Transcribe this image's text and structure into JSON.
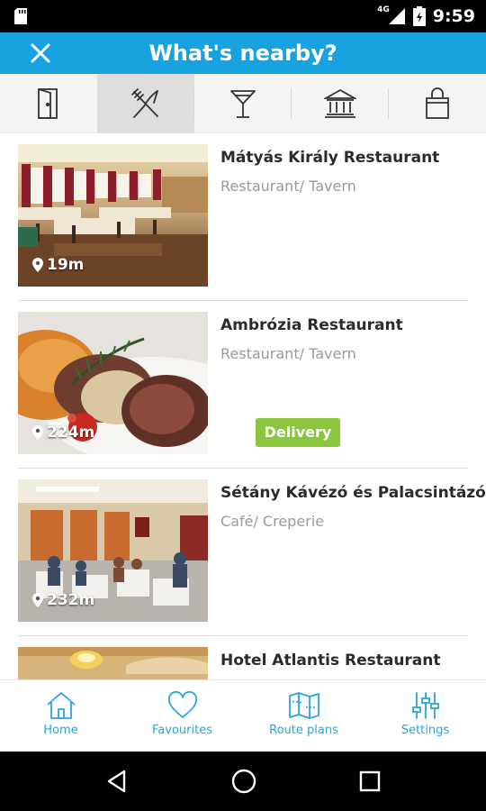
{
  "status_bar": {
    "time": "9:59",
    "network": "4G"
  },
  "app_bar": {
    "title": "What's nearby?",
    "close_icon": "close-icon"
  },
  "categories": [
    {
      "name": "door",
      "icon": "door-icon",
      "active": false
    },
    {
      "name": "restaurants",
      "icon": "fork-knife-icon",
      "active": true
    },
    {
      "name": "bars",
      "icon": "cocktail-icon",
      "active": false
    },
    {
      "name": "museums",
      "icon": "museum-icon",
      "active": false
    },
    {
      "name": "shopping",
      "icon": "shopping-bag-icon",
      "active": false
    }
  ],
  "places": [
    {
      "name": "Mátyás Király Restaurant",
      "type": "Restaurant/ Tavern",
      "distance": "19m"
    },
    {
      "name": "Ambrózia Restaurant",
      "type": "Restaurant/ Tavern",
      "distance": "224m",
      "badge": "Delivery"
    },
    {
      "name": "Sétány Kávézó és Palacsintázó",
      "type": "Café/ Creperie",
      "distance": "232m"
    },
    {
      "name": "Hotel Atlantis Restaurant",
      "type": "",
      "distance": ""
    }
  ],
  "bottom_nav": [
    {
      "label": "Home",
      "icon": "home-icon"
    },
    {
      "label": "Favourites",
      "icon": "heart-icon"
    },
    {
      "label": "Route plans",
      "icon": "map-icon"
    },
    {
      "label": "Settings",
      "icon": "sliders-icon"
    }
  ],
  "colors": {
    "accent": "#17a2e0",
    "delivery_badge": "#8cc63f"
  }
}
